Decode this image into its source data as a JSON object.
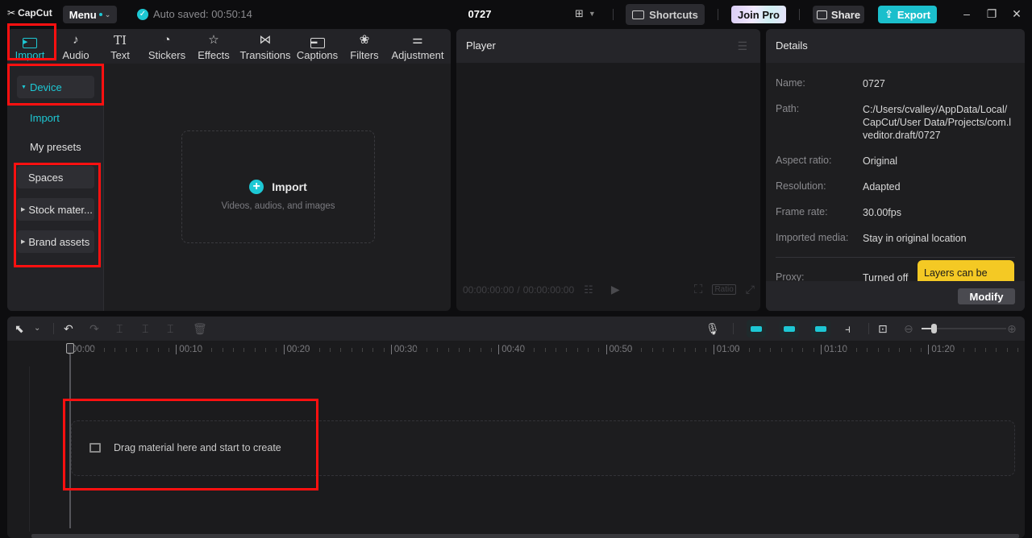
{
  "app": {
    "name": "CapCut"
  },
  "topbar": {
    "menu_label": "Menu",
    "autosave_text": "Auto saved: 00:50:14",
    "project_title": "0727",
    "shortcuts_label": "Shortcuts",
    "join_pro_label": "Join Pro",
    "share_label": "Share",
    "export_label": "Export"
  },
  "media_tabs": [
    {
      "label": "Import",
      "icon": "import-icon",
      "active": true
    },
    {
      "label": "Audio",
      "icon": "audio-icon"
    },
    {
      "label": "Text",
      "icon": "text-icon"
    },
    {
      "label": "Stickers",
      "icon": "stickers-icon"
    },
    {
      "label": "Effects",
      "icon": "effects-icon"
    },
    {
      "label": "Transitions",
      "icon": "transitions-icon"
    },
    {
      "label": "Captions",
      "icon": "captions-icon"
    },
    {
      "label": "Filters",
      "icon": "filters-icon"
    },
    {
      "label": "Adjustment",
      "icon": "adjustment-icon"
    }
  ],
  "sidebar": {
    "items": [
      {
        "label": "Device",
        "expanded": true
      },
      {
        "label": "Import",
        "active": true
      },
      {
        "label": "My presets"
      },
      {
        "label": "Spaces"
      },
      {
        "label": "Stock mater..."
      },
      {
        "label": "Brand assets"
      }
    ]
  },
  "import_box": {
    "title": "Import",
    "subtitle": "Videos, audios, and images"
  },
  "player": {
    "title": "Player",
    "current_time": "00:00:00:00",
    "total_time": "00:00:00:00",
    "ratio_label": "Ratio"
  },
  "details": {
    "title": "Details",
    "rows": [
      {
        "key": "Name:",
        "value": "0727"
      },
      {
        "key": "Path:",
        "value": "C:/Users/cvalley/AppData/Local/CapCut/User Data/Projects/com.lveditor.draft/0727"
      },
      {
        "key": "Aspect ratio:",
        "value": "Original"
      },
      {
        "key": "Resolution:",
        "value": "Adapted"
      },
      {
        "key": "Frame rate:",
        "value": "30.00fps"
      },
      {
        "key": "Imported media:",
        "value": "Stay in original location"
      },
      {
        "key": "Proxy:",
        "value": "Turned off"
      }
    ],
    "tooltip": "Layers can be",
    "modify_label": "Modify"
  },
  "timeline": {
    "ruler_labels": [
      "00:00",
      "00:10",
      "00:20",
      "00:30",
      "00:40",
      "00:50",
      "01:00",
      "01:10",
      "01:20"
    ],
    "drop_hint": "Drag material here and start to create"
  },
  "colors": {
    "accent": "#1dc8d4",
    "export": "#1bbfcc",
    "highlight_box": "#ff1010",
    "tooltip": "#f4c924"
  }
}
